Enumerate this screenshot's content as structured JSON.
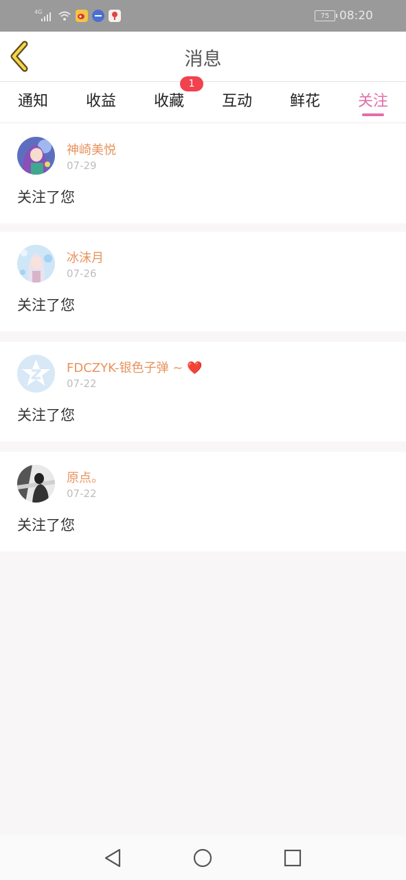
{
  "status_bar": {
    "network": "4G",
    "battery": "75",
    "time": "08:20",
    "app_icons": [
      "weibo-icon",
      "app-blue-icon",
      "app-red-icon"
    ]
  },
  "header": {
    "title": "消息"
  },
  "tabs": [
    {
      "label": "通知",
      "active": false
    },
    {
      "label": "收益",
      "active": false
    },
    {
      "label": "收藏",
      "active": false,
      "badge": "1"
    },
    {
      "label": "互动",
      "active": false
    },
    {
      "label": "鲜花",
      "active": false
    },
    {
      "label": "关注",
      "active": true
    }
  ],
  "messages": [
    {
      "username": "神崎美悦",
      "date": "07-29",
      "text": "关注了您",
      "avatar": "anime-girl-purple-avatar"
    },
    {
      "username": "冰沫月",
      "date": "07-26",
      "text": "关注了您",
      "avatar": "anime-girl-blue-avatar"
    },
    {
      "username": "FDCZYK-银色子弹 ~ ",
      "date": "07-22",
      "text": "关注了您",
      "avatar": "default-star-avatar",
      "emoji": "❤️"
    },
    {
      "username": "原点。",
      "date": "07-22",
      "text": "关注了您",
      "avatar": "grayscale-photo-avatar"
    }
  ],
  "colors": {
    "accent": "#e26ea8",
    "username": "#e8935e",
    "badge": "#f1424f",
    "status_bar": "#9a9a9a"
  },
  "nav_bar": {
    "icons": [
      "back-triangle-icon",
      "home-circle-icon",
      "recents-square-icon"
    ]
  }
}
